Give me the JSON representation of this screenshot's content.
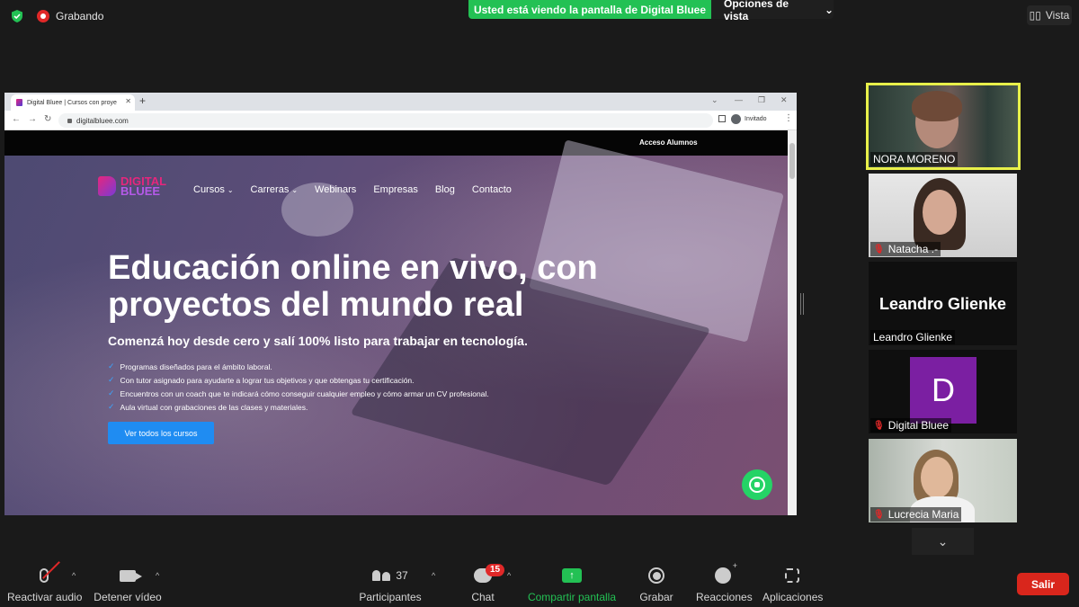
{
  "topbar": {
    "recording_label": "Grabando",
    "share_banner": "Usted está viendo la pantalla de Digital Bluee",
    "view_options": "Opciones de vista",
    "view_button": "Vista"
  },
  "browser": {
    "tab_title": "Digital Bluee | Cursos con proye",
    "url": "digitalbluee.com",
    "profile_label": "Invitado"
  },
  "site": {
    "top_link": "Acceso Alumnos",
    "logo_line1": "DIGITAL",
    "logo_line2": "BLUEE",
    "menu": [
      "Cursos",
      "Carreras",
      "Webinars",
      "Empresas",
      "Blog",
      "Contacto"
    ],
    "headline": "Educación online en vivo, con proyectos del mundo real",
    "subheadline": "Comenzá hoy desde cero y salí 100% listo para trabajar en tecnología.",
    "bullets": [
      "Programas diseñados para el ámbito laboral.",
      "Con tutor asignado para ayudarte a lograr tus objetivos y que obtengas tu certificación.",
      "Encuentros con un coach que te indicará cómo conseguir cualquier empleo y cómo armar un CV profesional.",
      "Aula virtual con grabaciones de las clases y materiales."
    ],
    "cta": "Ver todos los cursos"
  },
  "participants": [
    {
      "name": "NORA MORENO",
      "muted": false,
      "active_speaker": true
    },
    {
      "name": "Natacha .-",
      "muted": true
    },
    {
      "name": "Leandro Glienke",
      "muted": false,
      "display_name": "Leandro Glienke"
    },
    {
      "name": "Digital Bluee",
      "muted": true,
      "avatar_letter": "D"
    },
    {
      "name": "Lucrecia Maria",
      "muted": true
    }
  ],
  "toolbar": {
    "unmute": "Reactivar audio",
    "stop_video": "Detener vídeo",
    "participants": "Participantes",
    "participant_count": "37",
    "chat": "Chat",
    "chat_badge": "15",
    "share": "Compartir pantalla",
    "record": "Grabar",
    "reactions": "Reacciones",
    "apps": "Aplicaciones",
    "leave": "Salir"
  },
  "colors": {
    "share_green": "#23c154",
    "active_speaker_border": "#e8f04a",
    "leave_red": "#d9261c",
    "cta_blue": "#1f8cf2",
    "avatar_purple": "#7b1fa2"
  }
}
